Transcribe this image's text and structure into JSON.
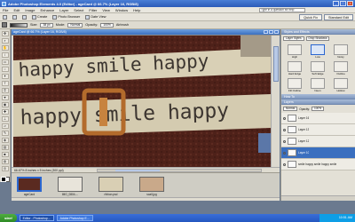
{
  "titlebar": {
    "title": "Adobe Photoshop Elements 4.0 (Editor) - ageCard @ 66.7% (Layer 16, RGB/8)"
  },
  "menubar": {
    "items": [
      "File",
      "Edit",
      "Image",
      "Enhance",
      "Layer",
      "Select",
      "Filter",
      "View",
      "Window",
      "Help"
    ],
    "help_placeholder": "Type in a question for help"
  },
  "shortcuts": {
    "items": [
      "Create",
      "Photo Browser",
      "Date View"
    ],
    "modes": [
      "Quick Fix",
      "Standard Edit"
    ]
  },
  "options": {
    "size_label": "Size:",
    "size_value": "38 px",
    "mode_label": "Mode:",
    "mode_value": "Normal",
    "opacity_label": "Opacity:",
    "opacity_value": "100%",
    "airbrush_label": "Airbrush"
  },
  "document": {
    "title": "ageCard @ 66.7% (Layer 16, RGB/8)",
    "status": "66.67%   8 inches x 5 inches (300 ppi)",
    "ribbon_text_1": "happy smile happy",
    "ribbon_text_2": "happy smile happy"
  },
  "bin": {
    "items": [
      {
        "label": "ageCard"
      },
      {
        "label": "IMG_0804-..."
      },
      {
        "label": "ribbon.psd"
      },
      {
        "label": "scall.jpg"
      }
    ]
  },
  "styles": {
    "header": "Styles and Effects",
    "category": "Layer Styles",
    "set": "Drop Shadows",
    "items": [
      "High",
      "Low",
      "Noisy",
      "Hard Edge",
      "Soft Edge",
      "Outline",
      "Fill Outline",
      "Neon",
      "Hollow"
    ]
  },
  "howto": {
    "header": "How To"
  },
  "layers": {
    "header": "Layers",
    "blend": "Normal",
    "opacity_label": "Opacity:",
    "opacity_value": "100%",
    "items": [
      {
        "name": "Layer 16"
      },
      {
        "name": "Layer 13"
      },
      {
        "name": "Layer 12"
      },
      {
        "name": "Layer 10"
      },
      {
        "name": "smile happy smile happy smile"
      }
    ]
  },
  "taskbar": {
    "start": "start",
    "tasks": [
      "Editor - Photoshop...",
      "Adobe Photoshop E..."
    ],
    "clock": "10:51 AM"
  }
}
